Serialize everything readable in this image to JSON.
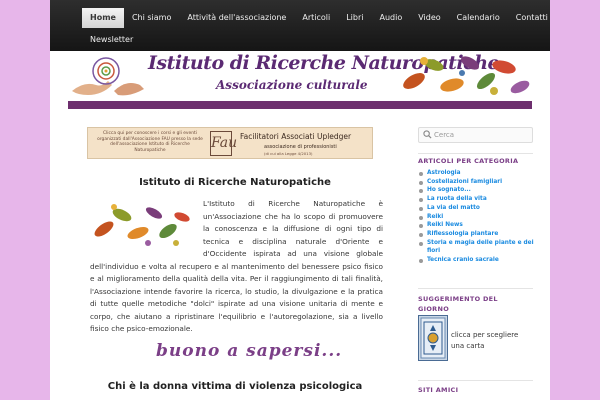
{
  "nav": {
    "items": [
      {
        "label": "Home",
        "active": true
      },
      {
        "label": "Chi siamo"
      },
      {
        "label": "Attività dell'associazione"
      },
      {
        "label": "Articoli"
      },
      {
        "label": "Libri"
      },
      {
        "label": "Audio"
      },
      {
        "label": "Video"
      },
      {
        "label": "Calendario"
      },
      {
        "label": "Contatti"
      }
    ],
    "second_row": [
      {
        "label": "Newsletter"
      }
    ]
  },
  "header": {
    "title": "Istituto di Ricerche Naturopatiche",
    "subtitle": "Associazione culturale"
  },
  "ad_banner": {
    "left_text": "Clicca qui per conoscere i corsi e gli eventi organizzati dall'Associazione FAU presso la sede dell'associazione Istituto di Ricerche Naturopatiche",
    "logo_text": "Fau",
    "name": "Facilitatori Associati Upledger",
    "description": "associazione di professionisti",
    "legal": "(di cui alla Legge 4/2013)"
  },
  "main": {
    "article_title": "Istituto di Ricerche Naturopatiche",
    "article_body": "L'Istituto di Ricerche Naturopatiche è un'Associazione che ha lo scopo di promuovere la conoscenza e la diffusione di ogni tipo di tecnica e disciplina naturale d'Oriente e d'Occidente ispirata ad una visione globale dell'individuo e volta al recupero e al mantenimento del benessere psico fisico e al miglioramento della qualità della vita. Per il raggiungimento di tali finalità, l'Associazione intende favorire la ricerca, lo studio, la divulgazione e la pratica di tutte quelle metodiche \"dolci\" ispirate ad una visione unitaria di mente e corpo, che aiutano a ripristinare l'equilibrio e l'autoregolazione, sia a livello fisico che psico-emozionale.",
    "buono_heading": "buono a sapersi...",
    "post_title": "Chi è la donna vittima di violenza psicologica"
  },
  "sidebar": {
    "search_placeholder": "Cerca",
    "categories_title": "ARTICOLI PER CATEGORIA",
    "categories": [
      "Astrologia",
      "Costellazioni famigliari",
      "Ho sognato...",
      "La ruota della vita",
      "La via del matto",
      "Reiki",
      "Reiki News",
      "Riflessologia plantare",
      "Storia e magia delle piante e dei fiori",
      "Tecnica cranio sacrale"
    ],
    "suggestion_title": "SUGGERIMENTO DEL GIORNO",
    "card_caption": "clicca per scegliere una carta",
    "friends_title": "SITI AMICI"
  },
  "colors": {
    "background": "#e7b6ea",
    "accent_purple": "#7b3f87",
    "link_blue": "#1b8be0",
    "nav_dark": "#222222"
  }
}
